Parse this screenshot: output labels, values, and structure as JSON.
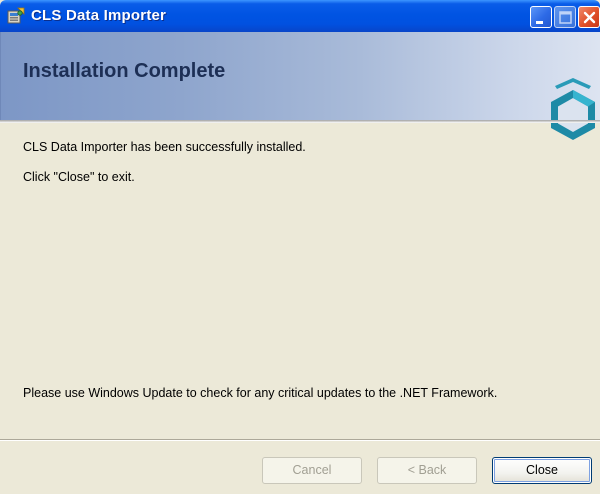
{
  "window": {
    "title": "CLS Data Importer"
  },
  "banner": {
    "title": "Installation Complete",
    "logo_icon": "hexagon-logo-icon"
  },
  "content": {
    "line1": "CLS Data Importer has been successfully installed.",
    "line2": "Click \"Close\" to exit.",
    "line3": "Please use Windows Update to check for any critical updates to the .NET Framework."
  },
  "buttons": {
    "cancel": {
      "label": "Cancel",
      "enabled": false
    },
    "back": {
      "label": "< Back",
      "enabled": false
    },
    "close": {
      "label": "Close",
      "enabled": true,
      "default": true
    }
  },
  "colors": {
    "titlebar_blue": "#0054e3",
    "window_face": "#ece9d8",
    "banner_start": "#7d97c6",
    "banner_end": "#dde4f1",
    "logo_teal": "#1e8aa6"
  },
  "icons": [
    "installer-app-icon",
    "minimize-icon",
    "maximize-icon",
    "close-icon",
    "hexagon-logo-icon"
  ]
}
